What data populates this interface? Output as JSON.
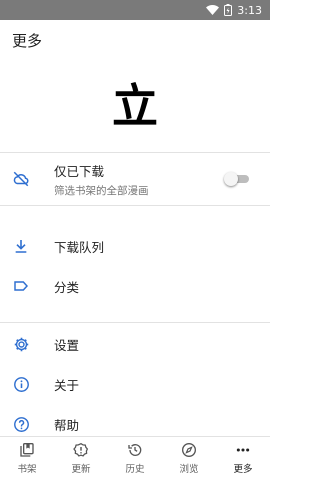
{
  "status_bar": {
    "time": "3:13"
  },
  "app_bar": {
    "title": "更多"
  },
  "logo": {
    "glyph": "立"
  },
  "settings_top": {
    "downloaded_only": {
      "label": "仅已下载",
      "description": "筛选书架的全部漫画",
      "enabled": false
    }
  },
  "menu": {
    "download_queue": "下载队列",
    "categories": "分类",
    "settings": "设置",
    "about": "关于",
    "help": "帮助"
  },
  "bottom_nav": {
    "library": "书架",
    "updates": "更新",
    "history": "历史",
    "browse": "浏览",
    "more": "更多",
    "active": "more"
  },
  "colors": {
    "accent": "#2f6fd0",
    "status_bar": "#7a7a7a"
  }
}
